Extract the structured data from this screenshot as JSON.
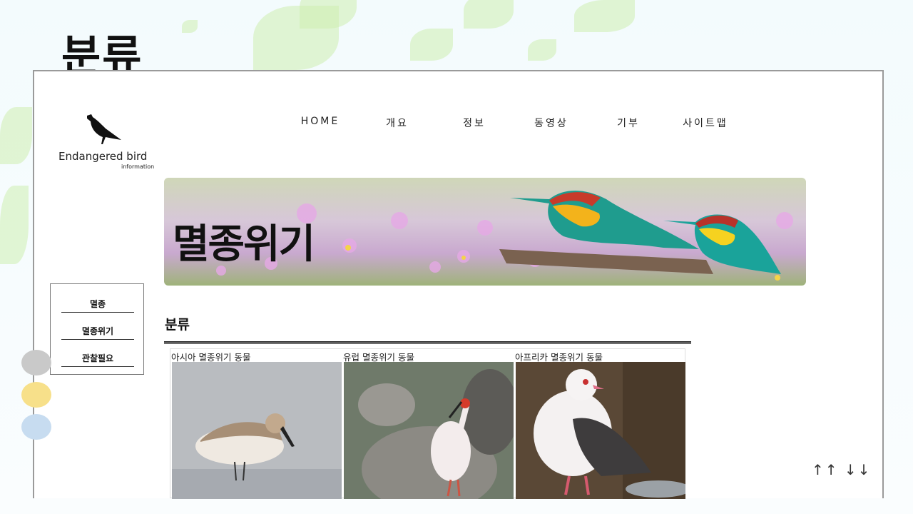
{
  "slide": {
    "title": "분류"
  },
  "site": {
    "logo": {
      "name": "Endangered bird",
      "sub": "information"
    },
    "nav": [
      "HOME",
      "개요",
      "정보",
      "동영상",
      "기부",
      "사이트맵"
    ],
    "banner": {
      "title": "멸종위기"
    },
    "side_menu": [
      "멸종",
      "멸종위기",
      "관찰필요"
    ],
    "section_title": "분류",
    "gallery": [
      {
        "caption": "아시아 멸종위기 동물"
      },
      {
        "caption": "유럽 멸종위기 동물"
      },
      {
        "caption": "아프리카 멸종위기 동물"
      }
    ]
  },
  "icons": {
    "logo": "bird-silhouette-icon",
    "slide_nav": [
      "arrow-up-icon",
      "arrow-up-icon",
      "arrow-down-icon",
      "arrow-down-icon"
    ]
  },
  "colors": {
    "text": "#111111",
    "frame": "#9a9a9a",
    "leaf": "#cdeeb0"
  }
}
